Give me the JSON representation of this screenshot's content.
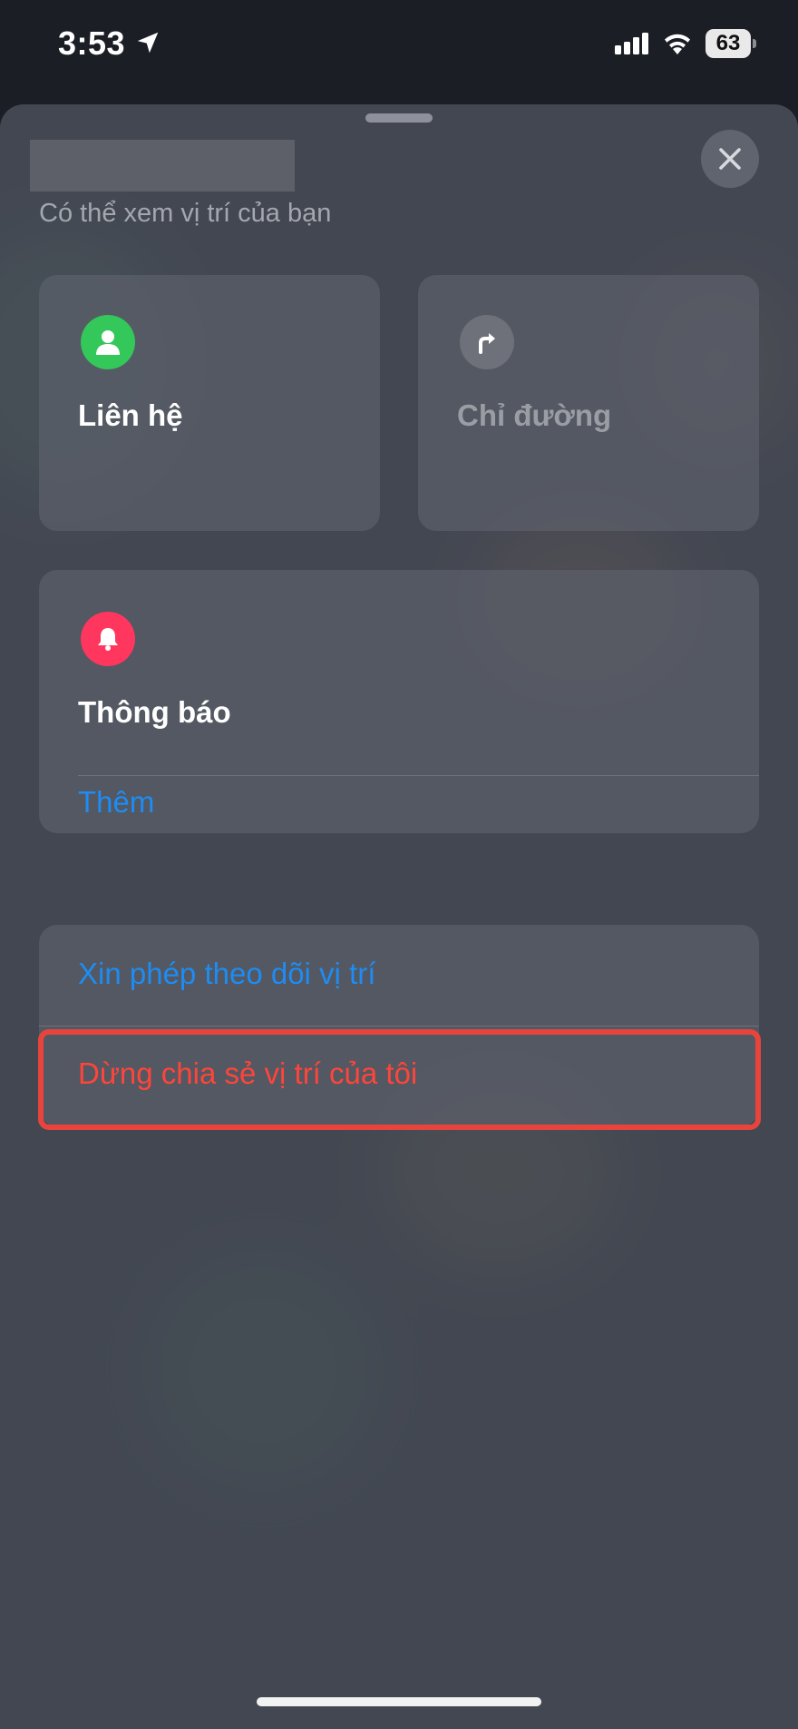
{
  "status_bar": {
    "time": "3:53",
    "battery": "63"
  },
  "sheet": {
    "subtitle": "Có thể xem vị trí của bạn",
    "contact": {
      "label": "Liên hệ",
      "icon": "person-icon",
      "icon_color": "#34c759"
    },
    "directions": {
      "label": "Chỉ đường",
      "icon": "turn-right-arrow-icon",
      "icon_color": "#6e7179"
    },
    "notifications": {
      "label": "Thông báo",
      "icon": "bell-icon",
      "icon_color": "#ff375f",
      "add_label": "Thêm"
    },
    "actions": {
      "request_follow": "Xin phép theo dõi vị trí",
      "stop_sharing": "Dừng chia sẻ vị trí của tôi"
    }
  },
  "colors": {
    "link_blue": "#1e8cf2",
    "destructive_red": "#ff453a",
    "highlight_border": "#e8443e"
  }
}
